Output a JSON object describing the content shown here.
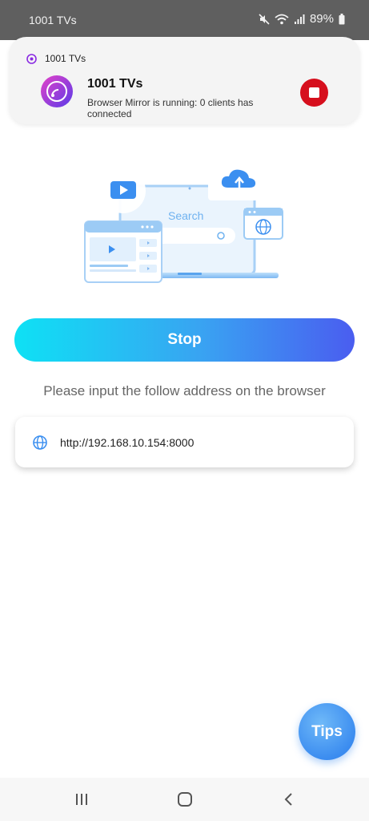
{
  "status_bar": {
    "app_name": "1001 TVs",
    "battery": "89%"
  },
  "notification": {
    "app_name": "1001 TVs",
    "title": "1001 TVs",
    "body": "Browser Mirror is running: 0 clients has connected",
    "stop_icon": "stop-icon",
    "accent_color": "#d60f1d"
  },
  "illustration": {
    "search_label": "Search"
  },
  "main": {
    "stop_label": "Stop",
    "instruction": "Please input the follow address on the browser",
    "address": "http://192.168.10.154:8000",
    "gradient_colors": [
      "#0ee1f4",
      "#39a3f2",
      "#4a5df0"
    ]
  },
  "tips": {
    "label": "Tips"
  },
  "nav": {
    "recent_icon": "recent-apps-icon",
    "home_icon": "home-icon",
    "back_icon": "back-icon"
  }
}
